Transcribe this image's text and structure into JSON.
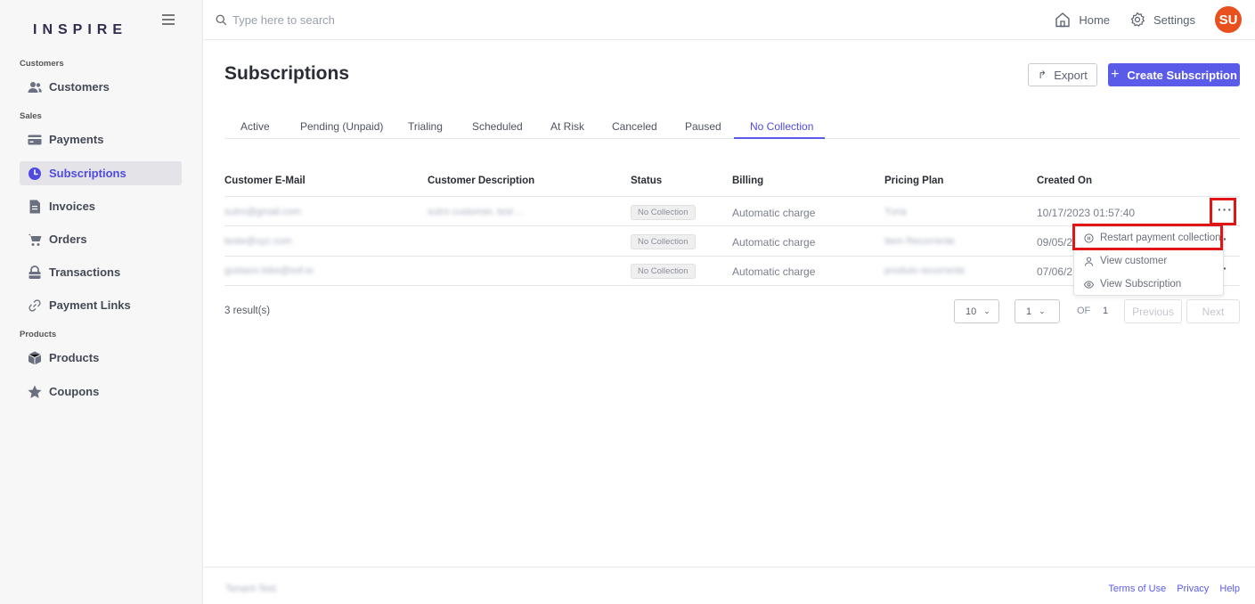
{
  "app": {
    "logo": "INSPIRE"
  },
  "sidebar": {
    "sections": [
      {
        "label": "Customers"
      },
      {
        "label": "Sales"
      },
      {
        "label": "Products"
      }
    ],
    "items": [
      {
        "label": "Customers",
        "icon": "users-icon"
      },
      {
        "label": "Payments",
        "icon": "card-icon"
      },
      {
        "label": "Subscriptions",
        "icon": "clock-icon",
        "active": true
      },
      {
        "label": "Invoices",
        "icon": "document-icon"
      },
      {
        "label": "Orders",
        "icon": "cart-icon"
      },
      {
        "label": "Transactions",
        "icon": "lock-icon"
      },
      {
        "label": "Payment Links",
        "icon": "link-icon"
      },
      {
        "label": "Products",
        "icon": "box-icon"
      },
      {
        "label": "Coupons",
        "icon": "star-icon"
      }
    ]
  },
  "topbar": {
    "search_placeholder": "Type here to search",
    "home_label": "Home",
    "settings_label": "Settings",
    "avatar_initials": "SU",
    "avatar_color": "#e8501e"
  },
  "main": {
    "title": "Subscriptions",
    "export_label": "Export",
    "create_label": "Create Subscription",
    "accent_color": "#5b5bea",
    "tabs": [
      {
        "label": "Active"
      },
      {
        "label": "Pending (Unpaid)"
      },
      {
        "label": "Trialing"
      },
      {
        "label": "Scheduled"
      },
      {
        "label": "At Risk"
      },
      {
        "label": "Canceled"
      },
      {
        "label": "Paused"
      },
      {
        "label": "No Collection",
        "active": true
      }
    ],
    "table": {
      "headers": [
        "Customer E-Mail",
        "Customer Description",
        "Status",
        "Billing",
        "Pricing Plan",
        "Created On"
      ],
      "rows": [
        {
          "email": "sutro@gmail.com",
          "description": "sutro customer, test ...",
          "status": "No Collection",
          "billing": "Automatic charge",
          "plan": "Tuna",
          "created": "10/17/2023 01:57:40"
        },
        {
          "email": "teste@xyz.com",
          "description": "",
          "status": "No Collection",
          "billing": "Automatic charge",
          "plan": "Item Recorrente",
          "created": "09/05/2"
        },
        {
          "email": "gustavo.lobo@sof.io",
          "description": "",
          "status": "No Collection",
          "billing": "Automatic charge",
          "plan": "produto recorrente",
          "created": "07/06/2"
        }
      ]
    },
    "row_menu": {
      "items": [
        {
          "label": "Restart payment collection",
          "icon": "play-circle-icon"
        },
        {
          "label": "View customer",
          "icon": "user-icon"
        },
        {
          "label": "View Subscription",
          "icon": "eye-icon"
        }
      ]
    },
    "pagination": {
      "results": "3 result(s)",
      "page_size": "10",
      "page": "1",
      "of_label": "OF",
      "total_pages": "1",
      "previous_label": "Previous",
      "next_label": "Next"
    }
  },
  "footer": {
    "tenant": "Tenant-Test",
    "links": [
      "Terms of Use",
      "Privacy",
      "Help"
    ]
  }
}
